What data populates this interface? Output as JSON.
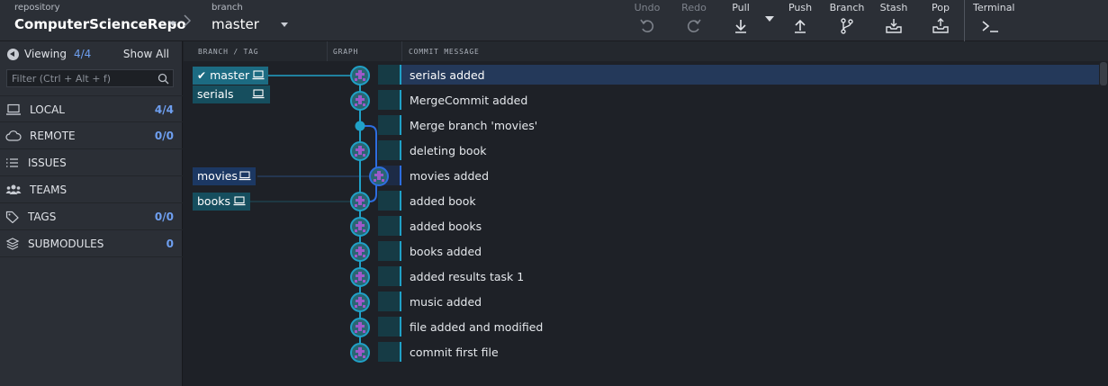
{
  "toolbar": {
    "repository_label": "repository",
    "repository_name": "ComputerScienceRepo",
    "branch_label": "branch",
    "branch_name": "master",
    "tools": [
      {
        "label": "Undo",
        "icon": "undo-icon",
        "enabled": false
      },
      {
        "label": "Redo",
        "icon": "redo-icon",
        "enabled": false
      },
      {
        "label": "Pull",
        "icon": "pull-icon",
        "enabled": true
      },
      {
        "label": "Push",
        "icon": "push-icon",
        "enabled": true
      },
      {
        "label": "Branch",
        "icon": "branch-icon",
        "enabled": true
      },
      {
        "label": "Stash",
        "icon": "stash-icon",
        "enabled": true
      },
      {
        "label": "Pop",
        "icon": "pop-icon",
        "enabled": true
      },
      {
        "label": "Terminal",
        "icon": "terminal-icon",
        "enabled": true
      }
    ]
  },
  "sidebar": {
    "viewing_label": "Viewing",
    "viewing_count": "4/4",
    "show_all": "Show All",
    "filter_placeholder": "Filter (Ctrl + Alt + f)",
    "sections": [
      {
        "label": "LOCAL",
        "count": "4/4",
        "icon": "laptop-icon"
      },
      {
        "label": "REMOTE",
        "count": "0/0",
        "icon": "cloud-icon"
      },
      {
        "label": "ISSUES",
        "count": "",
        "icon": "list-icon"
      },
      {
        "label": "TEAMS",
        "count": "",
        "icon": "people-icon"
      },
      {
        "label": "TAGS",
        "count": "0/0",
        "icon": "tag-icon"
      },
      {
        "label": "SUBMODULES",
        "count": "0",
        "icon": "layers-icon"
      }
    ]
  },
  "graph": {
    "columns": [
      "BRANCH / TAG",
      "GRAPH",
      "COMMIT MESSAGE"
    ],
    "refs": [
      {
        "name": "master",
        "checked_out": true,
        "row": 0
      },
      {
        "name": "serials",
        "checked_out": false,
        "row": 0
      },
      {
        "name": "movies",
        "checked_out": false,
        "row": 4
      },
      {
        "name": "books",
        "checked_out": false,
        "row": 5
      }
    ],
    "commits": [
      {
        "message": "serials added",
        "selected": true,
        "node": "avatar"
      },
      {
        "message": "MergeCommit added",
        "selected": false,
        "node": "avatar"
      },
      {
        "message": "Merge branch 'movies'",
        "selected": false,
        "node": "merge-dot"
      },
      {
        "message": "deleting book",
        "selected": false,
        "node": "avatar"
      },
      {
        "message": "movies added",
        "selected": false,
        "node": "avatar",
        "lane": 2
      },
      {
        "message": "added book",
        "selected": false,
        "node": "avatar"
      },
      {
        "message": "added books",
        "selected": false,
        "node": "avatar"
      },
      {
        "message": "books added",
        "selected": false,
        "node": "avatar"
      },
      {
        "message": "added results task 1",
        "selected": false,
        "node": "avatar"
      },
      {
        "message": "music added",
        "selected": false,
        "node": "avatar"
      },
      {
        "message": "file added and modified",
        "selected": false,
        "node": "avatar"
      },
      {
        "message": "commit first file",
        "selected": false,
        "node": "avatar"
      }
    ]
  },
  "colors": {
    "accent": "#20a1c7",
    "branch_lane": "#2d6ee0",
    "count": "#6e9ff0",
    "selection": "#24395a"
  }
}
